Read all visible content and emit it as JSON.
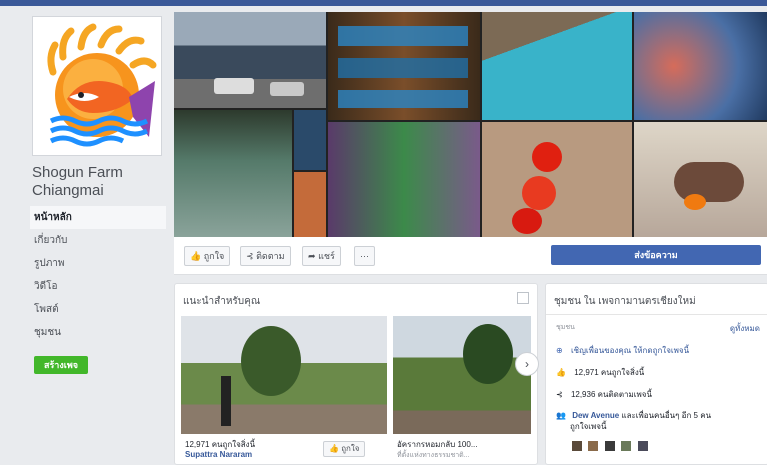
{
  "page": {
    "name_line1": "Shogun Farm",
    "name_line2": "Chiangmai"
  },
  "nav": {
    "items": [
      {
        "label": "หน้าหลัก",
        "active": true
      },
      {
        "label": "เกี่ยวกับ"
      },
      {
        "label": "รูปภาพ"
      },
      {
        "label": "วิดีโอ"
      },
      {
        "label": "โพสต์"
      },
      {
        "label": "ชุมชน"
      }
    ],
    "create_label": "สร้างเพจ"
  },
  "actions": {
    "like": "ถูกใจ",
    "follow": "ติดตาม",
    "share": "แชร์",
    "more": "···",
    "send_message": "ส่งข้อความ"
  },
  "recommend": {
    "title": "แนะนำสำหรับคุณ",
    "item1_count": "12,971 คนถูกใจสิ่งนี้",
    "item1_name": "Supattra Nararam",
    "item1_like": "ถูกใจ",
    "item2_title": "อัครากรหอมกลับ 100...",
    "item2_sub": "ที่ตั้งแห่งทางธรรมชาติ..."
  },
  "community": {
    "title": "ชุมชน ใน เพจกามานตรเชียงใหม่",
    "sub_label": "ชุมชน",
    "see_all": "ดูทั้งหมด",
    "invite": "เชิญเพื่อนของคุณ ให้กดถูกใจเพจนี้",
    "likes": "12,971 คนถูกใจสิ่งนี้",
    "follows": "12,936 คนติดตามเพจนี้",
    "friend_name": "Dew Avenue",
    "friend_tail": "และเพื่อนคนอื่นๆ อีก 5 คน",
    "friend_line2": "ถูกใจเพจนี้"
  },
  "colors": {
    "fb_blue": "#3b5998",
    "button_blue": "#4267b2",
    "green": "#42b72a",
    "background": "#e9ebee"
  }
}
